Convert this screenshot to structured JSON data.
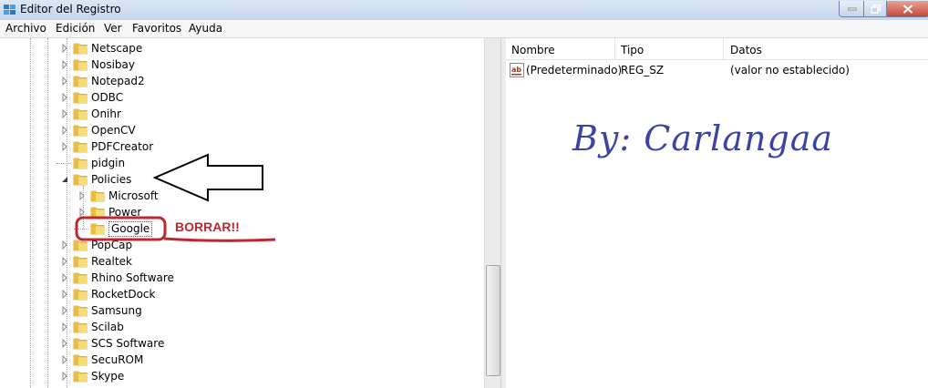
{
  "window": {
    "title": "Editor del Registro"
  },
  "menu": [
    "Archivo",
    "Edición",
    "Ver",
    "Favoritos",
    "Ayuda"
  ],
  "tree": {
    "items": [
      {
        "label": "Netscape",
        "level": 0,
        "expander": "collapsed"
      },
      {
        "label": "Nosibay",
        "level": 0,
        "expander": "collapsed"
      },
      {
        "label": "Notepad2",
        "level": 0,
        "expander": "collapsed"
      },
      {
        "label": "ODBC",
        "level": 0,
        "expander": "collapsed"
      },
      {
        "label": "Onihr",
        "level": 0,
        "expander": "collapsed"
      },
      {
        "label": "OpenCV",
        "level": 0,
        "expander": "collapsed"
      },
      {
        "label": "PDFCreator",
        "level": 0,
        "expander": "collapsed"
      },
      {
        "label": "pidgin",
        "level": 0,
        "expander": "none"
      },
      {
        "label": "Policies",
        "level": 0,
        "expander": "expanded"
      },
      {
        "label": "Microsoft",
        "level": 1,
        "expander": "collapsed"
      },
      {
        "label": "Power",
        "level": 1,
        "expander": "collapsed"
      },
      {
        "label": "Google",
        "level": 1,
        "expander": "none",
        "selected": true
      },
      {
        "label": "PopCap",
        "level": 0,
        "expander": "collapsed"
      },
      {
        "label": "Realtek",
        "level": 0,
        "expander": "collapsed"
      },
      {
        "label": "Rhino Software",
        "level": 0,
        "expander": "collapsed"
      },
      {
        "label": "RocketDock",
        "level": 0,
        "expander": "collapsed"
      },
      {
        "label": "Samsung",
        "level": 0,
        "expander": "collapsed"
      },
      {
        "label": "Scilab",
        "level": 0,
        "expander": "collapsed"
      },
      {
        "label": "SCS Software",
        "level": 0,
        "expander": "collapsed"
      },
      {
        "label": "SecuROM",
        "level": 0,
        "expander": "collapsed"
      },
      {
        "label": "Skype",
        "level": 0,
        "expander": "collapsed"
      }
    ]
  },
  "list": {
    "columns": [
      "Nombre",
      "Tipo",
      "Datos"
    ],
    "rows": [
      {
        "icon": "string-value-icon",
        "name": "(Predeterminado)",
        "type": "REG_SZ",
        "data": "(valor no establecido)"
      }
    ]
  },
  "annotations": {
    "watermark": "By: Carlangaa",
    "delete_note": "BORRAR!!"
  },
  "colors": {
    "annotation_red": "#c0262e",
    "watermark_blue": "#3a43a6",
    "folder_yellow": "#f2cf5b"
  }
}
